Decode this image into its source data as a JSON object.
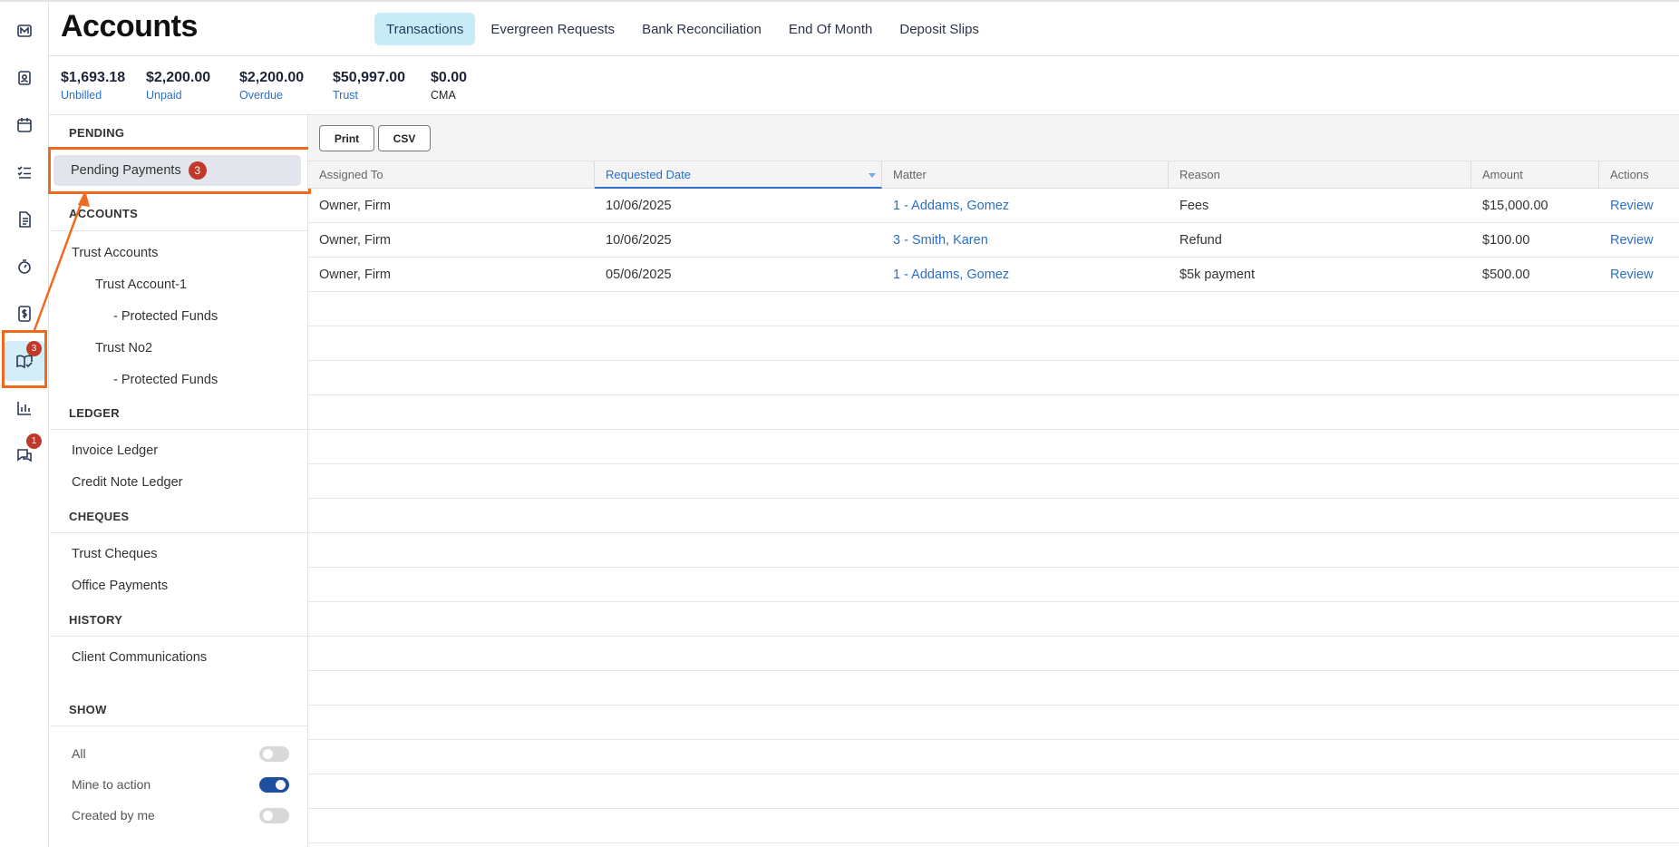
{
  "rail": {
    "items": [
      {
        "icon": "matter-logo-icon"
      },
      {
        "icon": "contacts-icon"
      },
      {
        "icon": "calendar-icon"
      },
      {
        "icon": "tasks-icon"
      },
      {
        "icon": "document-icon"
      },
      {
        "icon": "timer-icon"
      },
      {
        "icon": "billing-icon"
      },
      {
        "icon": "accounts-icon",
        "badge": "3"
      },
      {
        "icon": "reports-icon"
      },
      {
        "icon": "chat-icon",
        "badge": "1"
      }
    ]
  },
  "header": {
    "title": "Accounts",
    "tabs": [
      {
        "label": "Transactions",
        "active": true
      },
      {
        "label": "Evergreen Requests"
      },
      {
        "label": "Bank Reconciliation"
      },
      {
        "label": "End Of Month"
      },
      {
        "label": "Deposit Slips"
      }
    ]
  },
  "summary": [
    {
      "value": "$1,693.18",
      "label": "Unbilled"
    },
    {
      "value": "$2,200.00",
      "label": "Unpaid"
    },
    {
      "value": "$2,200.00",
      "label": "Overdue"
    },
    {
      "value": "$50,997.00",
      "label": "Trust"
    },
    {
      "value": "$0.00",
      "label": "CMA"
    }
  ],
  "sidebar": {
    "pending_heading": "PENDING",
    "pending_payments": {
      "label": "Pending Payments",
      "count": "3"
    },
    "accounts_heading": "ACCOUNTS",
    "trust_accounts": "Trust Accounts",
    "trust_account_1": "Trust Account-1",
    "protected_funds_1": "- Protected Funds",
    "trust_no2": "Trust No2",
    "protected_funds_2": "- Protected Funds",
    "ledger_heading": "LEDGER",
    "invoice_ledger": "Invoice Ledger",
    "credit_note_ledger": "Credit Note Ledger",
    "cheques_heading": "CHEQUES",
    "trust_cheques": "Trust Cheques",
    "office_payments": "Office Payments",
    "history_heading": "HISTORY",
    "client_communications": "Client Communications",
    "show_heading": "SHOW",
    "toggles": [
      {
        "label": "All",
        "on": false
      },
      {
        "label": "Mine to action",
        "on": true
      },
      {
        "label": "Created by me",
        "on": false
      }
    ]
  },
  "toolbar": {
    "print_label": "Print",
    "csv_label": "CSV"
  },
  "table": {
    "columns": [
      "Assigned To",
      "Requested Date",
      "Matter",
      "Reason",
      "Amount",
      "Actions"
    ],
    "sorted_column": "Requested Date",
    "rows": [
      {
        "assigned": "Owner, Firm",
        "date": "10/06/2025",
        "matter": "1 - Addams, Gomez",
        "reason": "Fees",
        "amount": "$15,000.00",
        "action": "Review"
      },
      {
        "assigned": "Owner, Firm",
        "date": "10/06/2025",
        "matter": "3 - Smith, Karen",
        "reason": "Refund",
        "amount": "$100.00",
        "action": "Review"
      },
      {
        "assigned": "Owner, Firm",
        "date": "05/06/2025",
        "matter": "1 - Addams, Gomez",
        "reason": "$5k payment",
        "amount": "$500.00",
        "action": "Review"
      }
    ]
  },
  "colors": {
    "accent": "#2a6fc9",
    "highlight": "#ee6a1e",
    "badge": "#c0392b",
    "active_tab": "#c8ecf7"
  }
}
